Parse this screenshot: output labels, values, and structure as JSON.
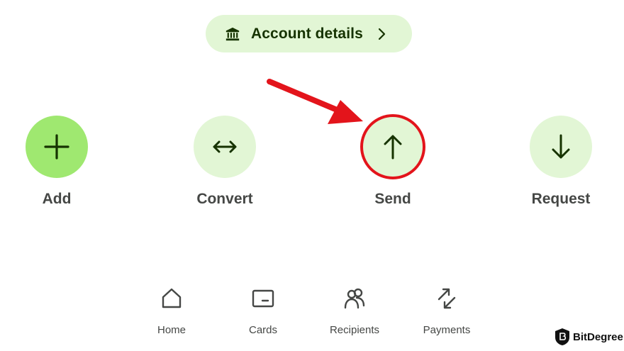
{
  "account": {
    "label": "Account details",
    "icon": "bank-icon",
    "chevron": "chevron-right-icon"
  },
  "actions": [
    {
      "label": "Add",
      "icon": "plus-icon",
      "primary": true
    },
    {
      "label": "Convert",
      "icon": "double-arrow-icon"
    },
    {
      "label": "Send",
      "icon": "arrow-up-icon",
      "highlighted": true
    },
    {
      "label": "Request",
      "icon": "arrow-down-icon"
    }
  ],
  "nav": [
    {
      "label": "Home",
      "icon": "home-icon"
    },
    {
      "label": "Cards",
      "icon": "card-icon"
    },
    {
      "label": "Recipients",
      "icon": "recipients-icon"
    },
    {
      "label": "Payments",
      "icon": "payments-icon"
    }
  ],
  "watermark": {
    "text": "BitDegree",
    "icon": "bitdegree-logo-icon"
  },
  "colors": {
    "pill_bg": "#e2f6d5",
    "primary_green": "#9fe870",
    "dark_green": "#163300",
    "highlight_red": "#e3141b",
    "label_gray": "#454745"
  }
}
